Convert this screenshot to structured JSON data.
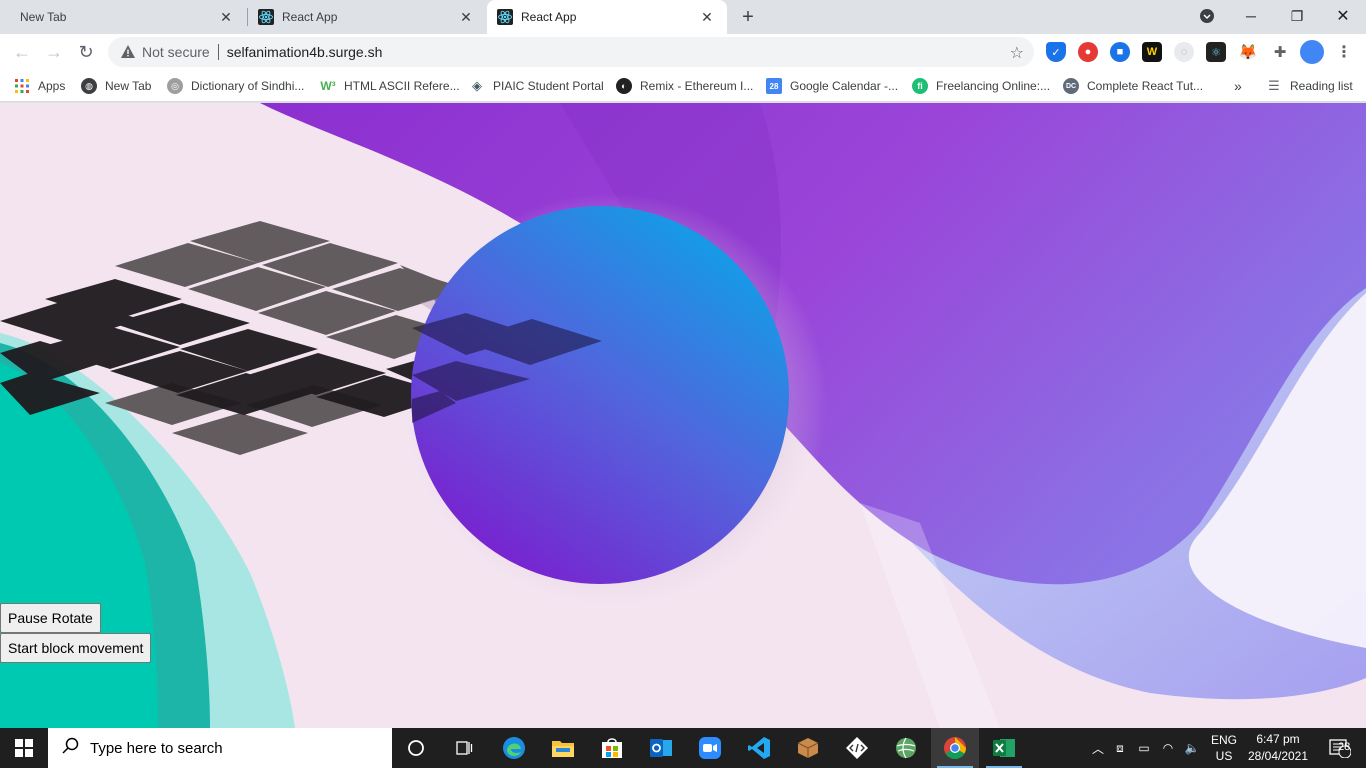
{
  "browser": {
    "tabs": [
      {
        "title": "New Tab",
        "active": false
      },
      {
        "title": "React App",
        "active": false
      },
      {
        "title": "React App",
        "active": true
      }
    ],
    "security_label": "Not secure",
    "url": "selfanimation4b.surge.sh"
  },
  "bookmarks": {
    "items": [
      {
        "label": "Apps",
        "icon": "apps-grid-icon"
      },
      {
        "label": "New Tab",
        "icon": "globe-icon"
      },
      {
        "label": "Dictionary of Sindhi...",
        "icon": "dictionary-icon"
      },
      {
        "label": "HTML ASCII Refere...",
        "icon": "w3schools-icon"
      },
      {
        "label": "PIAIC Student Portal",
        "icon": "piaic-icon"
      },
      {
        "label": "Remix - Ethereum I...",
        "icon": "remix-icon"
      },
      {
        "label": "Google Calendar -...",
        "icon": "calendar-icon"
      },
      {
        "label": "Freelancing Online:...",
        "icon": "fiverr-icon"
      },
      {
        "label": "Complete React Tut...",
        "icon": "dc-icon"
      }
    ],
    "overflow": "»",
    "reading_list": "Reading list"
  },
  "page": {
    "buttons": {
      "pause_rotate": "Pause Rotate",
      "start_block": "Start block movement"
    }
  },
  "taskbar": {
    "search_placeholder": "Type here to search",
    "lang_top": "ENG",
    "lang_bottom": "US",
    "time": "6:47 pm",
    "date": "28/04/2021",
    "notification_count": "28"
  },
  "colors": {
    "page_bg": "#f3e4f0",
    "purple": "#9b3fd6",
    "teal": "#00c8b0",
    "circle_top": "#0fa0e8",
    "circle_bottom": "#7b22d0"
  }
}
